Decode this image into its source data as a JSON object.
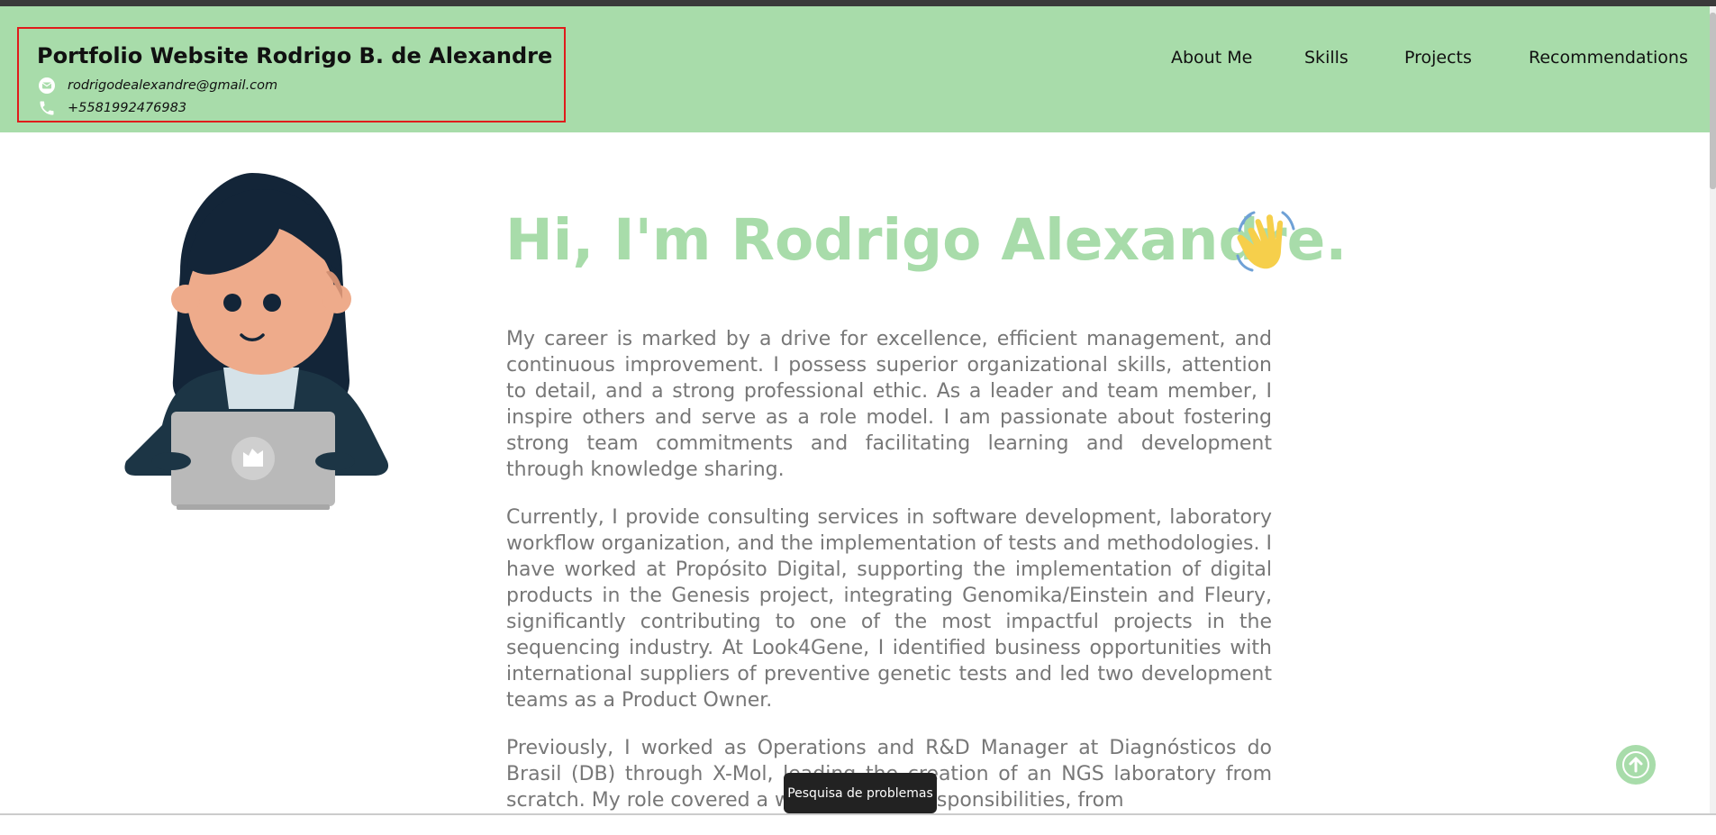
{
  "header": {
    "title": "Portfolio Website Rodrigo B. de Alexandre",
    "email": "rodrigodealexandre@gmail.com",
    "phone": "+5581992476983",
    "email_icon": "envelope-icon",
    "phone_icon": "phone-icon"
  },
  "nav": {
    "items": [
      {
        "label": "About Me"
      },
      {
        "label": "Skills"
      },
      {
        "label": "Projects"
      },
      {
        "label": "Recommendations"
      }
    ]
  },
  "hero": {
    "title": "Hi, I'm Rodrigo Alexandre.",
    "wave_icon": "waving-hand-icon",
    "avatar": "avatar-woman-laptop-illustration",
    "paragraphs": [
      "My career is marked by a drive for excellence, efficient management, and continuous improvement. I possess superior organizational skills, attention to detail, and a strong professional ethic. As a leader and team member, I inspire others and serve as a role model. I am passionate about fostering strong team commitments and facilitating learning and development through knowledge sharing.",
      "Currently, I provide consulting services in software development, laboratory workflow organization, and the implementation of tests and methodologies. I have worked at Propósito Digital, supporting the implementation of digital products in the Genesis project, integrating Genomika/Einstein and Fleury, significantly contributing to one of the most impactful projects in the sequencing industry. At Look4Gene, I identified business opportunities with international suppliers of preventive genetic tests and led two development teams as a Product Owner.",
      "Previously, I worked as Operations and R&D Manager at Diagnósticos do Brasil (DB) through X-Mol, leading the creation of an NGS laboratory from scratch. My role covered a wide range of responsibilities, from"
    ]
  },
  "tooltip": {
    "text": "Pesquisa de problemas"
  },
  "colors": {
    "accent": "#a8dcaa",
    "text": "#777777",
    "highlight_border": "#e01b1b"
  },
  "back_to_top_icon": "arrow-up-icon"
}
